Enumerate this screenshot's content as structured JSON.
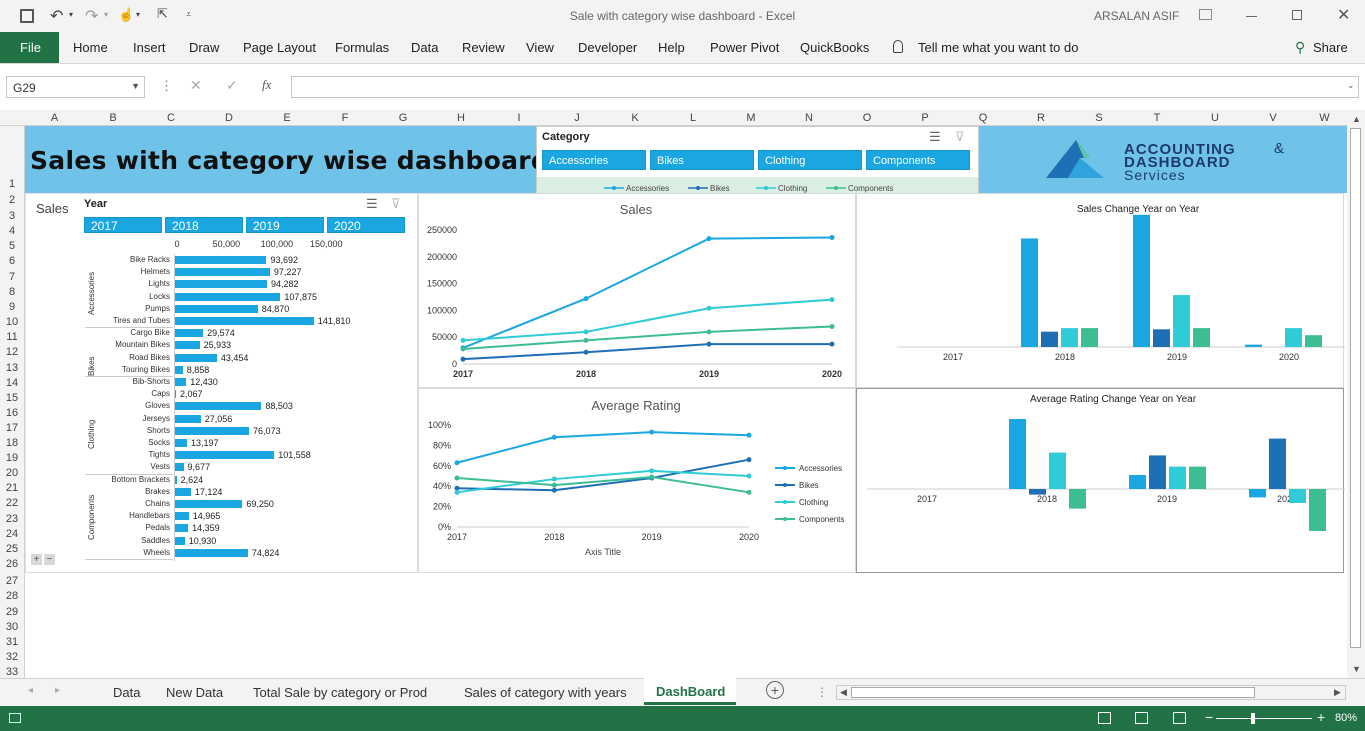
{
  "window": {
    "title": "Sale with category wise dashboard  -  Excel",
    "user": "ARSALAN ASIF"
  },
  "ribbon": {
    "file": "File",
    "tabs": [
      "Home",
      "Insert",
      "Draw",
      "Page Layout",
      "Formulas",
      "Data",
      "Review",
      "View",
      "Developer",
      "Help",
      "Power Pivot",
      "QuickBooks"
    ],
    "tell_me": "Tell me what you want to do",
    "share": "Share"
  },
  "formula": {
    "name_box": "G29",
    "fx": "fx",
    "content": ""
  },
  "columns": [
    "A",
    "B",
    "C",
    "D",
    "E",
    "F",
    "G",
    "H",
    "I",
    "J",
    "K",
    "L",
    "M",
    "N",
    "O",
    "P",
    "Q",
    "R",
    "S",
    "T",
    "U",
    "V",
    "W"
  ],
  "rows": [
    "1",
    "2",
    "3",
    "4",
    "5",
    "6",
    "7",
    "8",
    "9",
    "10",
    "11",
    "12",
    "13",
    "14",
    "15",
    "16",
    "17",
    "18",
    "19",
    "20",
    "21",
    "22",
    "23",
    "24",
    "25",
    "26",
    "27",
    "28",
    "29",
    "30",
    "31",
    "32",
    "33"
  ],
  "dashboard": {
    "title": "Sales with category wise dashboard",
    "logo": {
      "line1": "ACCOUNTING",
      "amp": "&",
      "line2": "DASHBOARD",
      "line3": "Services"
    },
    "category_slicer": {
      "header": "Category",
      "items": [
        "Accessories",
        "Bikes",
        "Clothing",
        "Components"
      ]
    },
    "year_slicer": {
      "header": "Year",
      "items": [
        "2017",
        "2018",
        "2019",
        "2020"
      ]
    },
    "sales_label": "Sales"
  },
  "colors": {
    "accessories": "#1aa7e1",
    "bikes": "#1f6fb5",
    "clothing": "#2fcbd6",
    "components": "#3dbd94",
    "green": "#217346",
    "header_blue": "#70c3e8"
  },
  "chart_data": [
    {
      "type": "bar",
      "orientation": "horizontal",
      "title": "",
      "axis_ticks": [
        "0",
        "50,000",
        "100,000",
        "150,000"
      ],
      "xlim": [
        0,
        150000
      ],
      "groups": [
        {
          "name": "Accessories",
          "items": [
            {
              "label": "Bike Racks",
              "value": 93692,
              "display": "93,692"
            },
            {
              "label": "Helmets",
              "value": 97227,
              "display": "97,227"
            },
            {
              "label": "Lights",
              "value": 94282,
              "display": "94,282"
            },
            {
              "label": "Locks",
              "value": 107875,
              "display": "107,875"
            },
            {
              "label": "Pumps",
              "value": 84870,
              "display": "84,870"
            },
            {
              "label": "Tires and Tubes",
              "value": 141810,
              "display": "141,810"
            }
          ]
        },
        {
          "name": "Bikes",
          "items": [
            {
              "label": "Cargo Bike",
              "value": 29574,
              "display": "29,574"
            },
            {
              "label": "Mountain Bikes",
              "value": 25933,
              "display": "25,933"
            },
            {
              "label": "Road Bikes",
              "value": 43454,
              "display": "43,454"
            },
            {
              "label": "Touring Bikes",
              "value": 8858,
              "display": "8,858"
            }
          ]
        },
        {
          "name": "Clothing",
          "items": [
            {
              "label": "Bib-Shorts",
              "value": 12430,
              "display": "12,430"
            },
            {
              "label": "Caps",
              "value": 2067,
              "display": "2,067"
            },
            {
              "label": "Gloves",
              "value": 88503,
              "display": "88,503"
            },
            {
              "label": "Jerseys",
              "value": 27056,
              "display": "27,056"
            },
            {
              "label": "Shorts",
              "value": 76073,
              "display": "76,073"
            },
            {
              "label": "Socks",
              "value": 13197,
              "display": "13,197"
            },
            {
              "label": "Tights",
              "value": 101558,
              "display": "101,558"
            },
            {
              "label": "Vests",
              "value": 9677,
              "display": "9,677"
            }
          ]
        },
        {
          "name": "Components",
          "items": [
            {
              "label": "Bottom Brackets",
              "value": 2624,
              "display": "2,624"
            },
            {
              "label": "Brakes",
              "value": 17124,
              "display": "17,124"
            },
            {
              "label": "Chains",
              "value": 69250,
              "display": "69,250"
            },
            {
              "label": "Handlebars",
              "value": 14965,
              "display": "14,965"
            },
            {
              "label": "Pedals",
              "value": 14359,
              "display": "14,359"
            },
            {
              "label": "Saddles",
              "value": 10930,
              "display": "10,930"
            },
            {
              "label": "Wheels",
              "value": 74824,
              "display": "74,824"
            }
          ]
        }
      ]
    },
    {
      "type": "line",
      "title": "Sales",
      "x": [
        "2017",
        "2018",
        "2019",
        "2020"
      ],
      "ylim": [
        0,
        250000
      ],
      "yticks": [
        "250000",
        "200000",
        "150000",
        "100000",
        "50000",
        "0"
      ],
      "series": [
        {
          "name": "Accessories",
          "values": [
            30000,
            122000,
            234000,
            236000
          ]
        },
        {
          "name": "Bikes",
          "values": [
            9000,
            22000,
            37000,
            37000
          ]
        },
        {
          "name": "Clothing",
          "values": [
            44000,
            60000,
            104000,
            120000
          ]
        },
        {
          "name": "Components",
          "values": [
            28000,
            44000,
            60000,
            70000
          ]
        }
      ],
      "legend": [
        "Accessories",
        "Bikes",
        "Clothing",
        "Components"
      ],
      "legend_position": "top"
    },
    {
      "type": "line",
      "title": "Average Rating",
      "xlabel": "Axis Title",
      "x": [
        "2017",
        "2018",
        "2019",
        "2020"
      ],
      "ylim": [
        0,
        1
      ],
      "yticks": [
        "100%",
        "80%",
        "60%",
        "40%",
        "20%",
        "0%"
      ],
      "series": [
        {
          "name": "Accessories",
          "values": [
            0.63,
            0.88,
            0.93,
            0.9
          ]
        },
        {
          "name": "Bikes",
          "values": [
            0.38,
            0.36,
            0.48,
            0.66
          ]
        },
        {
          "name": "Clothing",
          "values": [
            0.34,
            0.47,
            0.55,
            0.5
          ]
        },
        {
          "name": "Components",
          "values": [
            0.48,
            0.41,
            0.49,
            0.34
          ]
        }
      ],
      "legend": [
        "Accessories",
        "Bikes",
        "Clothing",
        "Components"
      ],
      "legend_position": "right"
    },
    {
      "type": "bar",
      "title": "Sales Change Year on Year",
      "categories": [
        "2017",
        "2018",
        "2019",
        "2020"
      ],
      "series": [
        {
          "name": "Accessories",
          "values": [
            0,
            92000,
            112000,
            2000
          ]
        },
        {
          "name": "Bikes",
          "values": [
            0,
            13000,
            15000,
            0
          ]
        },
        {
          "name": "Clothing",
          "values": [
            0,
            16000,
            44000,
            16000
          ]
        },
        {
          "name": "Components",
          "values": [
            0,
            16000,
            16000,
            10000
          ]
        }
      ]
    },
    {
      "type": "bar",
      "title": "Average Rating Change Year on Year",
      "categories": [
        "2017",
        "2018",
        "2019",
        "2020"
      ],
      "series": [
        {
          "name": "Accessories",
          "values": [
            0,
            0.25,
            0.05,
            -0.03
          ]
        },
        {
          "name": "Bikes",
          "values": [
            0,
            -0.02,
            0.12,
            0.18
          ]
        },
        {
          "name": "Clothing",
          "values": [
            0,
            0.13,
            0.08,
            -0.05
          ]
        },
        {
          "name": "Components",
          "values": [
            0,
            -0.07,
            0.08,
            -0.15
          ]
        }
      ]
    }
  ],
  "sheet_tabs": [
    "Data",
    "New Data",
    "Total Sale by category or Prod",
    "Sales of category with years",
    "DashBoard"
  ],
  "active_tab": "DashBoard",
  "status": {
    "zoom": "80%"
  }
}
